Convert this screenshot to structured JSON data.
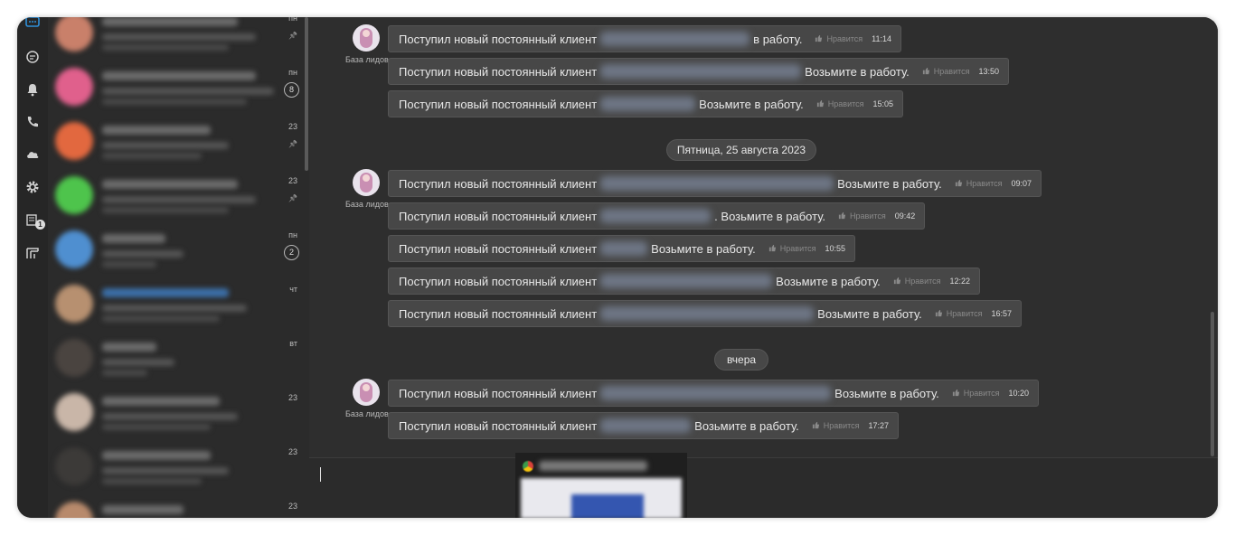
{
  "app": {
    "name": "Messenger chat window"
  },
  "colors": {
    "window_bg": "#2e2e2e",
    "sidebar_bg": "#2b2b2b",
    "bubble_bg": "#474747",
    "accent": "#2f8fd8"
  },
  "rail": {
    "icons": [
      "chat-icon",
      "messages-icon",
      "bell-icon",
      "phone-icon",
      "cloud-icon",
      "gear-icon",
      "tasks-icon",
      "board-icon"
    ],
    "tasks_badge": "1"
  },
  "chat_list": {
    "items": [
      {
        "date": "пн",
        "count": "",
        "pinned": true
      },
      {
        "date": "пн",
        "count": "8",
        "pinned": false
      },
      {
        "date": "23",
        "count": "",
        "pinned": true
      },
      {
        "date": "23",
        "count": "",
        "pinned": true
      },
      {
        "date": "пн",
        "count": "2",
        "pinned": false
      },
      {
        "date": "чт",
        "count": "",
        "pinned": false
      },
      {
        "date": "вт",
        "count": "",
        "pinned": false
      },
      {
        "date": "23",
        "count": "",
        "pinned": false
      },
      {
        "date": "23",
        "count": "",
        "pinned": false
      },
      {
        "date": "23",
        "count": "",
        "pinned": false
      }
    ]
  },
  "messages": {
    "sender_name": "База лидов",
    "like_label": "Нравится",
    "overlap_date_text": "густа 2023",
    "groups": [
      {
        "date": "",
        "items": [
          {
            "prefix": "Поступил новый постоянный клиент",
            "suffix": "в работу.",
            "time": "11:14"
          },
          {
            "prefix": "Поступил новый постоянный клиент",
            "suffix": "Возьмите в работу.",
            "time": "13:50"
          },
          {
            "prefix": "Поступил новый постоянный клиент",
            "suffix": "Возьмите в работу.",
            "time": "15:05"
          }
        ]
      },
      {
        "date": "Пятница, 25 августа 2023",
        "items": [
          {
            "prefix": "Поступил новый постоянный клиент",
            "suffix": "Возьмите в работу.",
            "time": "09:07"
          },
          {
            "prefix": "Поступил новый постоянный клиент",
            "suffix": ". Возьмите в работу.",
            "time": "09:42"
          },
          {
            "prefix": "Поступил новый постоянный клиент",
            "suffix": "Возьмите в работу.",
            "time": "10:55"
          },
          {
            "prefix": "Поступил новый постоянный клиент",
            "suffix": "Возьмите в работу.",
            "time": "12:22"
          },
          {
            "prefix": "Поступил новый постоянный клиент",
            "suffix": "Возьмите в работу.",
            "time": "16:57"
          }
        ]
      },
      {
        "date": "вчера",
        "items": [
          {
            "prefix": "Поступил новый постоянный клиент",
            "suffix": "Возьмите в работу.",
            "time": "10:20"
          },
          {
            "prefix": "Поступил новый постоянный клиент",
            "suffix": "Возьмите в работу.",
            "time": "17:27"
          }
        ]
      }
    ]
  },
  "input": {
    "value": ""
  }
}
